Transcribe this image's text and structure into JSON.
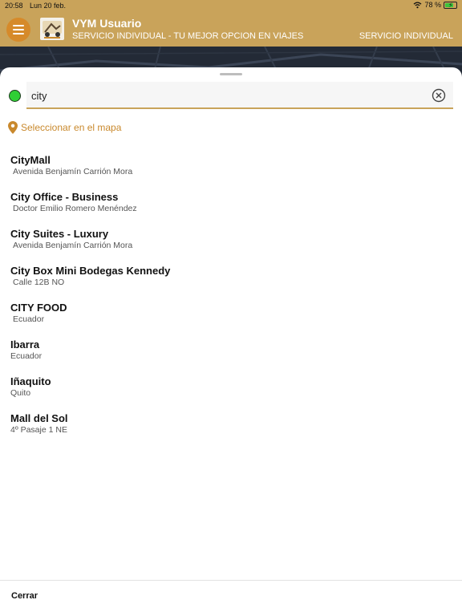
{
  "statusbar": {
    "time": "20:58",
    "date": "Lun 20 feb.",
    "battery_text": "78 %"
  },
  "header": {
    "title": "VYM Usuario",
    "subtitle": "SERVICIO INDIVIDUAL  - TU MEJOR OPCION EN VIAJES",
    "service_label": "SERVICIO INDIVIDUAL"
  },
  "search": {
    "value": "city",
    "placeholder": ""
  },
  "pick_on_map": {
    "label": "Seleccionar en el mapa"
  },
  "results": [
    {
      "name": "CityMall",
      "address": "Avenida Benjamín Carrión Mora"
    },
    {
      "name": "City Office - Business",
      "address": "Doctor Emilio Romero Menéndez"
    },
    {
      "name": "City Suites - Luxury",
      "address": "Avenida Benjamín Carrión Mora"
    },
    {
      "name": "City Box Mini Bodegas Kennedy",
      "address": "Calle 12B NO"
    },
    {
      "name": "CITY FOOD",
      "address": "Ecuador"
    },
    {
      "name": "Ibarra",
      "address": "Ecuador"
    },
    {
      "name": "Iñaquito",
      "address": "Quito"
    },
    {
      "name": "Mall del Sol",
      "address": "4º Pasaje 1 NE"
    }
  ],
  "footer": {
    "close_label": "Cerrar"
  },
  "colors": {
    "header_gold": "#c9a35a",
    "menu_orange": "#d68a2a",
    "accent_orange": "#c9892d",
    "origin_green": "#2fcf35"
  },
  "icons": {
    "menu": "hamburger-icon",
    "wifi": "wifi-icon",
    "battery": "battery-charging-icon",
    "origin": "green-dot-icon",
    "clear": "close-circle-icon",
    "pin": "map-pin-icon"
  }
}
